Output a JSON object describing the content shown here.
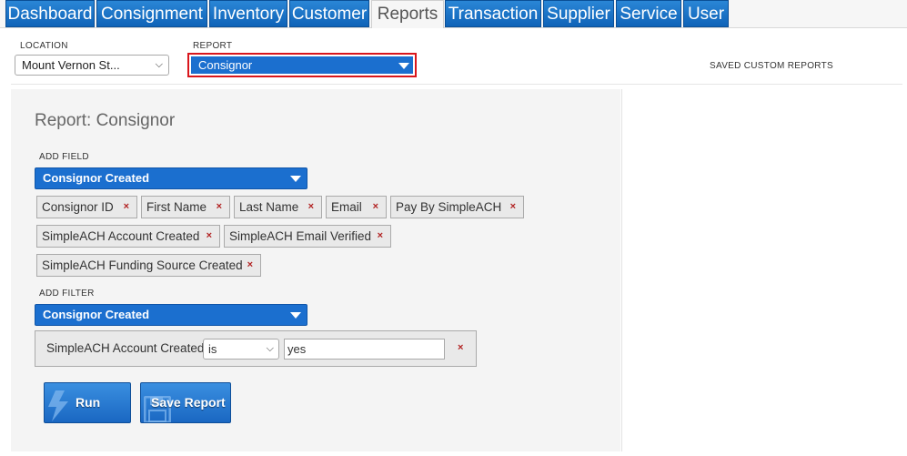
{
  "nav": {
    "tabs": [
      {
        "label": "Dashboard"
      },
      {
        "label": "Consignment"
      },
      {
        "label": "Inventory"
      },
      {
        "label": "Customer"
      },
      {
        "label": "Reports"
      },
      {
        "label": "Transaction"
      },
      {
        "label": "Supplier"
      },
      {
        "label": "Service"
      },
      {
        "label": "User"
      }
    ],
    "active": "Reports"
  },
  "header": {
    "location_label": "LOCATION",
    "location_value": "Mount Vernon St...",
    "report_label": "REPORT",
    "report_value": "Consignor",
    "saved_label": "SAVED CUSTOM REPORTS"
  },
  "report": {
    "title": "Report: Consignor",
    "add_field_label": "ADD FIELD",
    "add_field_value": "Consignor Created",
    "fields": [
      {
        "label": "Consignor ID"
      },
      {
        "label": "First Name"
      },
      {
        "label": "Last Name"
      },
      {
        "label": "Email"
      },
      {
        "label": "Pay By SimpleACH"
      },
      {
        "label": "SimpleACH Account Created"
      },
      {
        "label": "SimpleACH Email Verified"
      },
      {
        "label": "SimpleACH Funding Source Created"
      }
    ],
    "remove_glyph": "×",
    "add_filter_label": "ADD FILTER",
    "add_filter_value": "Consignor Created",
    "filter": {
      "field": "SimpleACH Account Created",
      "operator": "is",
      "value": "yes"
    },
    "run_label": "Run",
    "save_label": "Save Report"
  },
  "colors": {
    "accent": "#1b6fcf",
    "highlight": "#d9161c",
    "remove": "#b22222"
  },
  "icons": {
    "run": "lightning-bolt-icon",
    "save": "floppy-disk-icon"
  }
}
